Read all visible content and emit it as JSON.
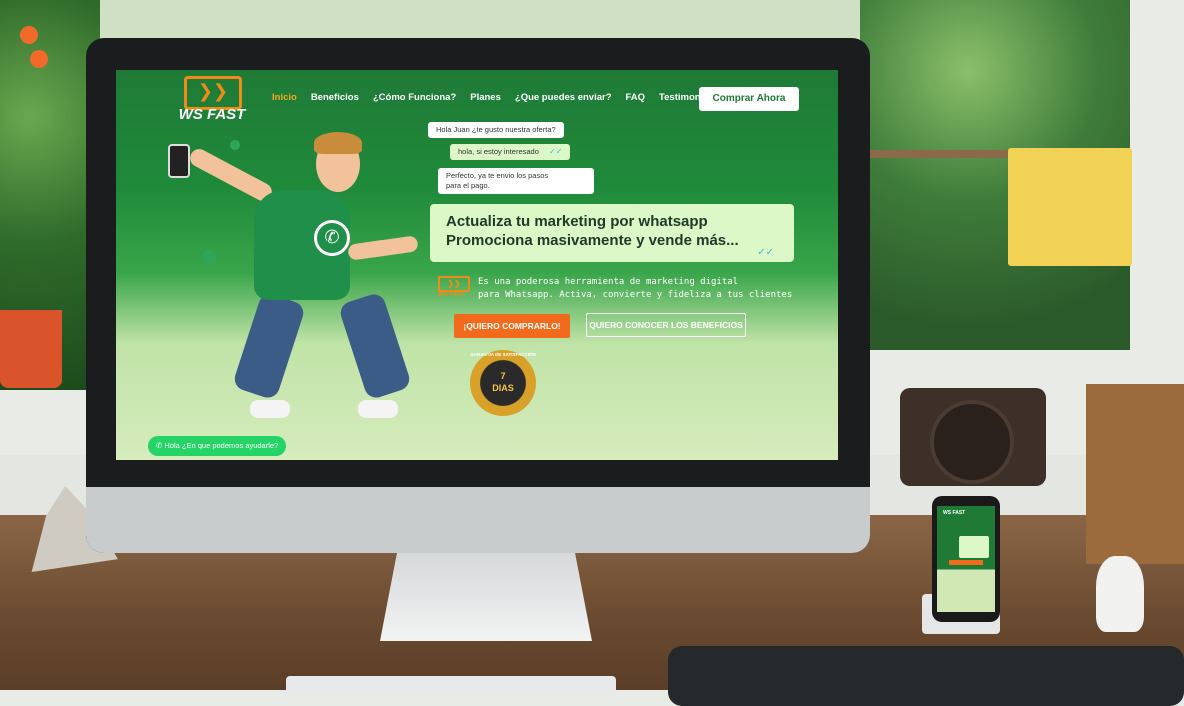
{
  "site": {
    "logo_glyph": "❯❯",
    "logo_text": "WS FAST",
    "nav": [
      {
        "label": "Inicio",
        "active": true
      },
      {
        "label": "Beneficios"
      },
      {
        "label": "¿Cómo Funciona?"
      },
      {
        "label": "Planes"
      },
      {
        "label": "¿Que puedes enviar?"
      },
      {
        "label": "FAQ"
      },
      {
        "label": "Testimonios"
      }
    ],
    "buy_button": "Comprar Ahora"
  },
  "chat": {
    "msg1": "Hola Juan ¿te gusto nuestra oferta?",
    "msg2": "hola, si estoy interesado",
    "msg3_line1": "Perfecto, ya te envio los pasos",
    "msg3_line2": "para el pago.",
    "check_icon": "✓✓"
  },
  "hero": {
    "headline_line1": "Actualiza tu marketing por whatsapp",
    "headline_line2": "Promociona masivamente y vende más...",
    "mini_logo_glyph": "❯❯",
    "mini_logo_text": "WS FAST",
    "description_line1": "Es una poderosa herramienta de marketing digital",
    "description_line2": "para Whatsapp. Activa, convierte y fideliza a tus clientes",
    "cta_primary": "¡QUIERO COMPRARLO!",
    "cta_secondary": "QUIERO CONOCER LOS BENEFICIOS"
  },
  "badge": {
    "ring_text": "GARANTÍA DE SATISFACCIÓN",
    "number": "7",
    "unit": "DIAS"
  },
  "whatsapp_widget": {
    "icon": "✆",
    "label": "Hola ¿En que podemos ayudarle?"
  },
  "colors": {
    "brand_green": "#1f7a36",
    "accent_orange": "#f26b1d",
    "nav_active": "#f5a623",
    "chat_sent": "#dcf8c6"
  }
}
